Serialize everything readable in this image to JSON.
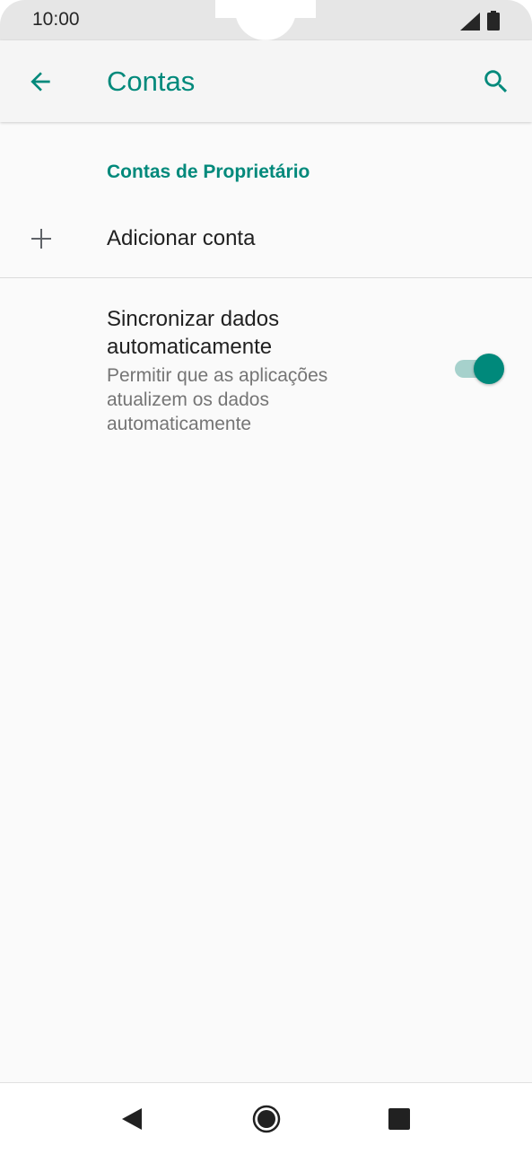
{
  "status_bar": {
    "time": "10:00",
    "icons": [
      "signal-icon",
      "battery-icon"
    ]
  },
  "app_bar": {
    "title": "Contas",
    "back_icon": "arrow-back-icon",
    "search_icon": "search-icon"
  },
  "accounts": {
    "section_header": "Contas de Proprietário",
    "add_account_label": "Adicionar conta",
    "add_icon": "plus-icon"
  },
  "sync": {
    "title": "Sincronizar dados automaticamente",
    "summary": "Permitir que as aplicações atualizem os dados automaticamente",
    "enabled": true
  },
  "colors": {
    "accent": "#00897b",
    "background": "#fafafa",
    "toggle_track": "#a6d1cc"
  },
  "nav_bar": {
    "icons": [
      "nav-back-icon",
      "nav-home-icon",
      "nav-recents-icon"
    ]
  }
}
